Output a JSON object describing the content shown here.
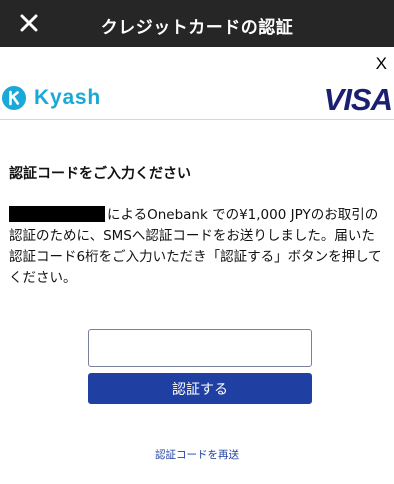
{
  "header": {
    "title": "クレジットカードの認証"
  },
  "dismiss": {
    "label": "X"
  },
  "brand": {
    "left_name": "Kyash",
    "right_name": "VISA",
    "accent": "#1aa8d8",
    "visa_color": "#1a1f71"
  },
  "main": {
    "heading": "認証コードをご入力ください",
    "message_part1": "によるOnebank での¥1,000 JPYのお取引の認証のために、SMSへ認証コードをお送りしました。届いた認証コード6桁をご入力いただき「認証する」ボタンを押してください。",
    "code_input_value": "",
    "submit_label": "認証する",
    "resend_label": "認証コードを再送"
  },
  "colors": {
    "titlebar": "#262626",
    "button": "#1f3fa2"
  }
}
